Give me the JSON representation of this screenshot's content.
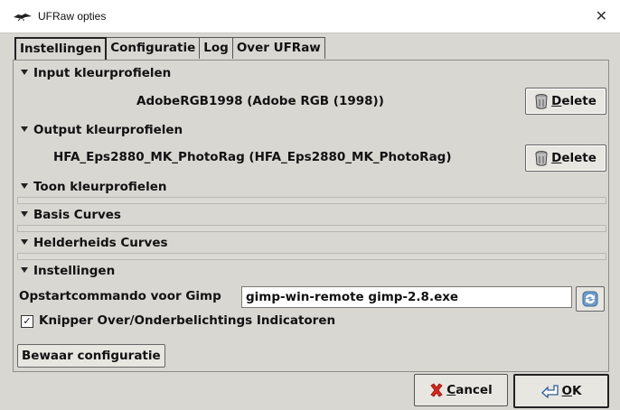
{
  "window": {
    "title": "UFRaw opties",
    "close_glyph": "✕"
  },
  "tabs": [
    {
      "label": "Instellingen",
      "active": true
    },
    {
      "label": "Configuratie",
      "active": false
    },
    {
      "label": "Log",
      "active": false
    },
    {
      "label": "Over UFRaw",
      "active": false
    }
  ],
  "sections": {
    "input": {
      "header": "Input kleurprofielen",
      "profile": "AdobeRGB1998 (Adobe RGB (1998))",
      "delete_first": "D",
      "delete_rest": "elete"
    },
    "output": {
      "header": "Output kleurprofielen",
      "profile": "HFA_Eps2880_MK_PhotoRag (HFA_Eps2880_MK_PhotoRag)",
      "delete_first": "D",
      "delete_rest": "elete"
    },
    "toon": {
      "header": "Toon kleurprofielen"
    },
    "basis": {
      "header": "Basis Curves"
    },
    "helderheid": {
      "header": "Helderheids Curves"
    },
    "instellingen": {
      "header": "Instellingen",
      "startup_label": "Opstartcommando voor Gimp",
      "startup_value": "gimp-win-remote gimp-2.8.exe",
      "blink_label": "Knipper Over/Onderbelichtings Indicatoren",
      "blink_checked": true,
      "checkmark": "✓"
    }
  },
  "save_button": "Bewaar configuratie",
  "buttons": {
    "cancel_first": "C",
    "cancel_rest": "ancel",
    "ok_first": "O",
    "ok_rest": "K"
  },
  "icons": [
    "app-bird-icon",
    "close-icon",
    "expander-triangle-icon",
    "trash-icon",
    "refresh-icon",
    "cancel-x-icon",
    "ok-arrow-icon"
  ]
}
